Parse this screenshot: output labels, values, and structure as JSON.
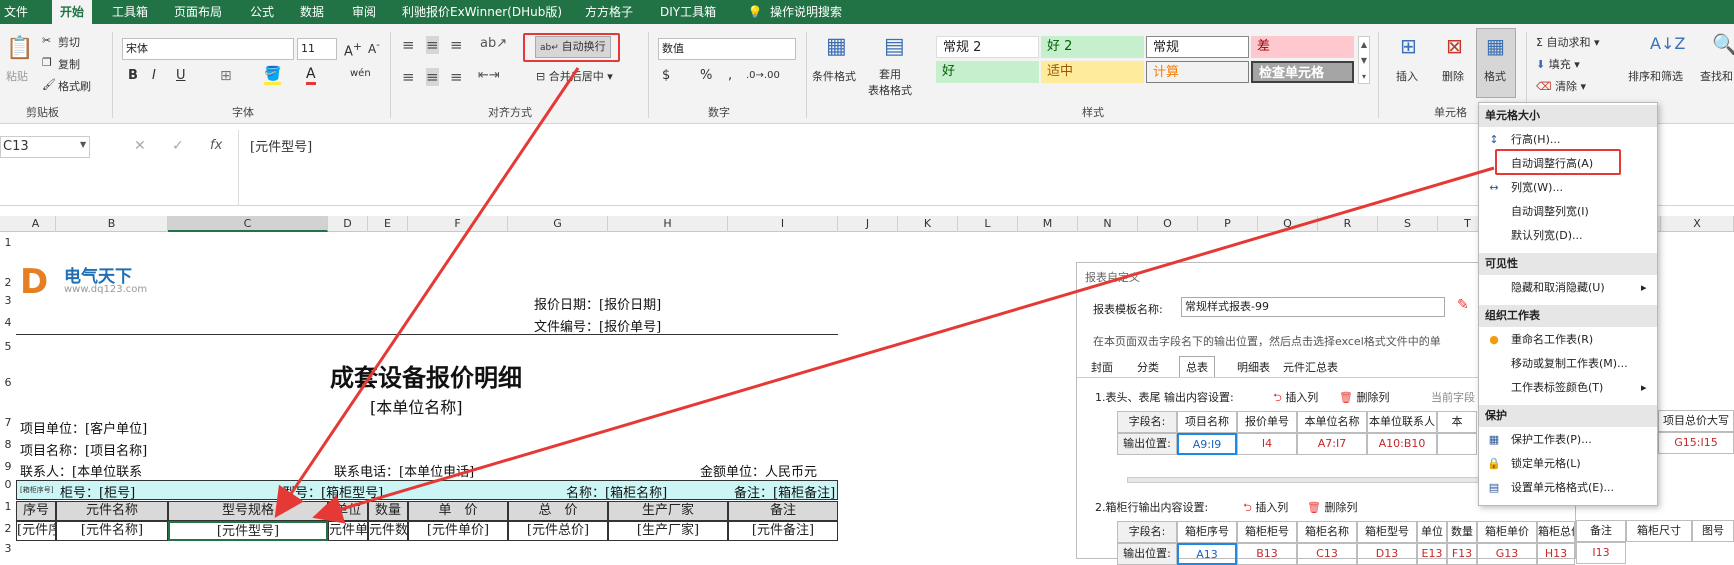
{
  "tabs": [
    "文件",
    "开始",
    "工具箱",
    "页面布局",
    "公式",
    "数据",
    "审阅",
    "利驰报价ExWinner(DHub版)",
    "方方格子",
    "DIY工具箱",
    "操作说明搜索"
  ],
  "ribbon": {
    "clipboard": {
      "paste": "粘贴",
      "cut": "剪切",
      "copy": "复制",
      "painter": "格式刷",
      "label": "剪贴板"
    },
    "font": {
      "name": "宋体",
      "size": "11",
      "label": "字体",
      "bold": "B",
      "italic": "I",
      "underline": "U",
      "wen": "wén"
    },
    "align": {
      "wrap": "自动换行",
      "merge": "合并后居中",
      "label": "对齐方式"
    },
    "number": {
      "format": "数值",
      "label": "数字",
      "currency": "$",
      "percent": "%",
      "comma": ","
    },
    "styles": {
      "cond": "条件格式",
      "table_fmt": "套用\n表格格式",
      "label": "样式",
      "cells": [
        "常规 2",
        "好 2",
        "常规",
        "差",
        "好",
        "适中",
        "计算",
        "检查单元格"
      ]
    },
    "cells": {
      "insert": "插入",
      "delete": "删除",
      "format": "格式",
      "label": "单元格"
    },
    "edit": {
      "autosum": "自动求和",
      "fill": "填充",
      "clear": "清除",
      "sort": "排序和筛选",
      "find": "查找和"
    }
  },
  "formula": {
    "namebox": "C13",
    "fx": "fx",
    "content": "[元件型号]"
  },
  "columns": [
    "A",
    "B",
    "C",
    "D",
    "E",
    "F",
    "G",
    "H",
    "I",
    "J",
    "K",
    "L",
    "M",
    "N",
    "O",
    "P",
    "Q",
    "R",
    "S",
    "T",
    "X"
  ],
  "rows": [
    "1",
    "2",
    "3",
    "4",
    "5",
    "6",
    "7",
    "8",
    "9",
    "0",
    "1",
    "2",
    "3",
    "4"
  ],
  "sheet": {
    "logo_main": "电气天下",
    "logo_url": "www.dq123.com",
    "date": "报价日期：[报价日期]",
    "docno": "文件编号：[报价单号]",
    "title": "成套设备报价明细",
    "unit": "[本单位名称]",
    "proj_unit": "项目单位：[客户单位]",
    "proj_name": "项目名称：[项目名称]",
    "contact": "联系人：[本单位联系",
    "phone": "联系电话：[本单位电话]",
    "currency": "金额单位：人民币元",
    "cab_tag": "[箱柜序号]",
    "cab_no": "柜号：[柜号]",
    "cab_model": "型号：[箱柜型号]",
    "cab_name": "名称：[箱柜名称]",
    "cab_note": "备注：[箱柜备注]",
    "headers": [
      "序号",
      "元件名称",
      "型号规格",
      "单位",
      "数量",
      "单　价",
      "总　价",
      "生产厂家",
      "备注"
    ],
    "datarow": [
      "[元件序号]",
      "[元件名称]",
      "[元件型号]",
      "元件单",
      "元件数量",
      "[元件单价]",
      "[元件总价]",
      "[生产厂家]",
      "[元件备注]"
    ]
  },
  "dialog": {
    "title": "报表自定义",
    "tpl_label": "报表模板名称:",
    "tpl_value": "常规样式报表-99",
    "hint": "在本页面双击字段名下的输出位置，然后点击选择excel格式文件中的单",
    "tabs": [
      "封面",
      "分类",
      "总表",
      "明细表",
      "元件汇总表"
    ],
    "sec1": "1.表头、表尾 输出内容设置:",
    "insert": "插入列",
    "delcol": "删除列",
    "cur": "当前字段",
    "row1_label": "字段名:",
    "row1": [
      "项目名称",
      "报价单号",
      "本单位名称",
      "本单位联系人",
      "本"
    ],
    "row2_label": "输出位置:",
    "row2": [
      "A9:I9",
      "I4",
      "A7:I7",
      "A10:B10",
      ""
    ],
    "right1": "项目总价大写",
    "right2": "G15:I15",
    "sec2": "2.箱柜行输出内容设置:",
    "row3": [
      "字段名:",
      "箱柜序号",
      "箱柜柜号",
      "箱柜名称",
      "箱柜型号",
      "单位",
      "数量",
      "箱柜单价",
      "箱柜总价",
      "备注",
      "箱柜尺寸",
      "图号"
    ],
    "row4": [
      "输出位置:",
      "A13",
      "B13",
      "C13",
      "D13",
      "E13",
      "F13",
      "G13",
      "H13",
      "I13",
      "",
      ""
    ]
  },
  "menu": {
    "h1": "单元格大小",
    "row_height": "行高(H)...",
    "auto_row": "自动调整行高(A)",
    "col_width": "列宽(W)...",
    "auto_col": "自动调整列宽(I)",
    "default_col": "默认列宽(D)...",
    "h2": "可见性",
    "hide": "隐藏和取消隐藏(U)",
    "h3": "组织工作表",
    "rename": "重命名工作表(R)",
    "move": "移动或复制工作表(M)...",
    "tabcolor": "工作表标签颜色(T)",
    "h4": "保护",
    "protect": "保护工作表(P)...",
    "lock": "锁定单元格(L)",
    "format_cells": "设置单元格格式(E)..."
  },
  "colors": {
    "excel_green": "#217346",
    "red": "#e53935"
  }
}
